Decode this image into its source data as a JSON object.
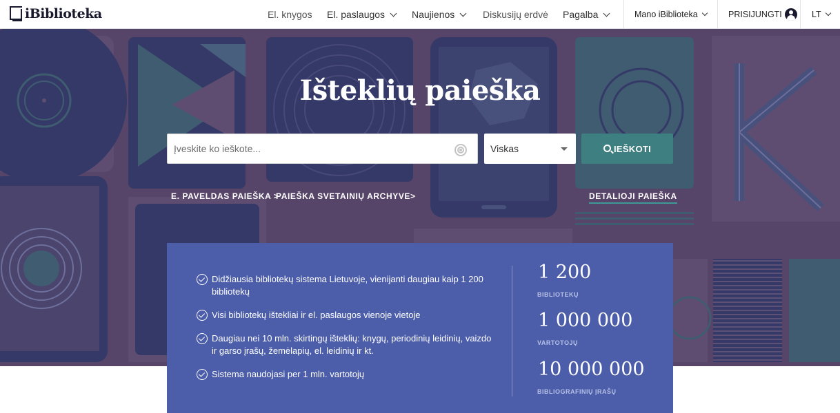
{
  "header": {
    "logo": "iBiblioteka",
    "nav": {
      "ebooks": "El. knygos",
      "eservices": "El. paslaugos",
      "news": "Naujienos",
      "forum": "Diskusijų erdvė",
      "help": "Pagalba"
    },
    "my_library": "Mano iBiblioteka",
    "login": "PRISIJUNGTI",
    "language": "LT"
  },
  "hero": {
    "title": "Išteklių paieška",
    "search": {
      "placeholder": "Įveskite ko ieškote..."
    },
    "scope": {
      "selected": "Viskas"
    },
    "search_button": "IEŠKOTI",
    "links": {
      "epaveldas": "E. PAVELDAS PAIEŠKA >",
      "archive": "PAIEŠKA SVETAINIŲ ARCHYVE>",
      "advanced": "DETALIOJI PAIEŠKA"
    }
  },
  "info": {
    "features": [
      {
        "text": "Didžiausia bibliotekų sistema Lietuvoje, vienijanti daugiau kaip 1 200 bibliotekų"
      },
      {
        "text": "Visi bibliotekų ištekliai ir el. paslaugos vienoje vietoje"
      },
      {
        "text": "Daugiau nei 10 mln. skirtingų išteklių: knygų, periodinių leidinių, vaizdo ir garso įrašų, žemėlapių, el. leidinių ir kt."
      },
      {
        "text": "Sistema naudojasi per 1 mln. vartotojų"
      }
    ],
    "stats": [
      {
        "value": "1 200",
        "label": "BIBLIOTEKŲ"
      },
      {
        "value": "1 000 000",
        "label": "VARTOTOJŲ"
      },
      {
        "value": "10 000 000",
        "label": "BIBLIOGRAFINIŲ ĮRAŠŲ"
      }
    ]
  },
  "colors": {
    "hero_bg": "#5d4b6e",
    "tile_navy": "#2f3b6d",
    "tile_teal": "#3d6b7a",
    "search_button": "#3e7f82",
    "info_panel": "#4c5daa",
    "link_underline": "#3e9a96"
  },
  "icons": [
    "logo-icon",
    "chevron-down-icon",
    "user-icon",
    "target-icon",
    "caret-down-icon",
    "search-icon",
    "check-circle-icon"
  ]
}
